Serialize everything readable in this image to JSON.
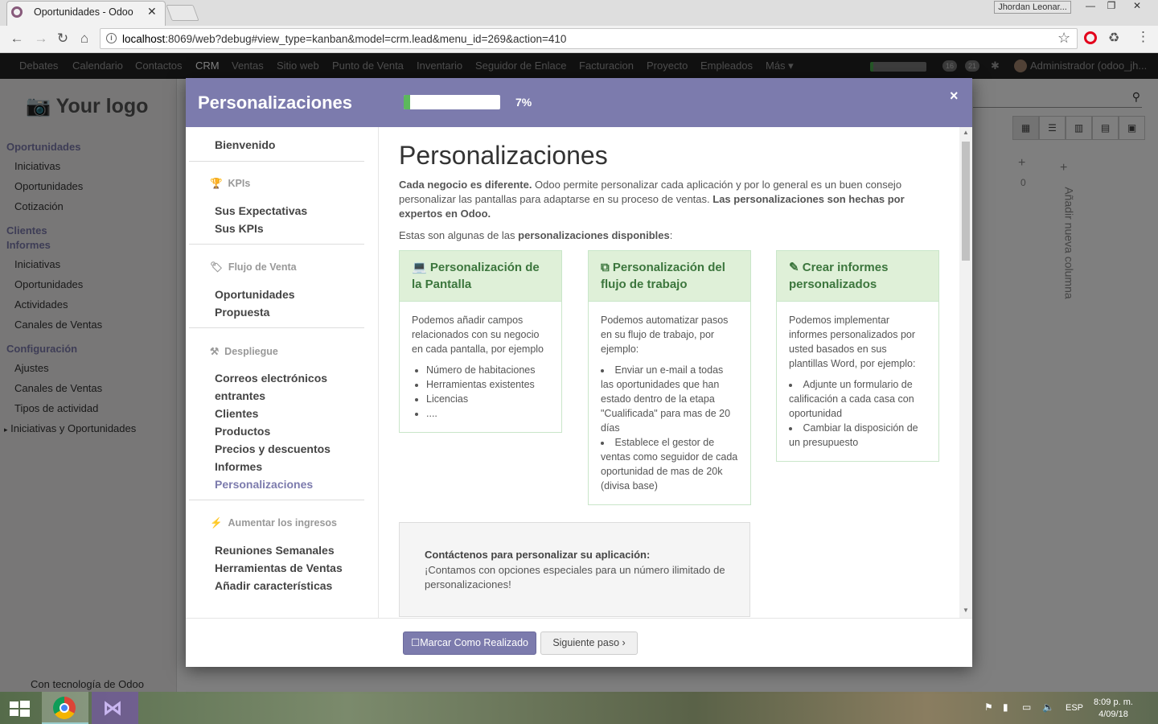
{
  "browser": {
    "tab_title": "Oportunidades - Odoo",
    "tab_close": "✕",
    "user_chip": "Jhordan Leonar...",
    "url_host": "localhost",
    "url_rest": ":8069/web?debug#view_type=kanban&model=crm.lead&menu_id=269&action=410"
  },
  "topnav": {
    "items": [
      "Debates",
      "Calendario",
      "Contactos",
      "CRM",
      "Ventas",
      "Sitio web",
      "Punto de Venta",
      "Inventario",
      "Seguidor de Enlace",
      "Facturacion",
      "Proyecto",
      "Empleados",
      "Más"
    ],
    "badge1": "16",
    "badge2": "21",
    "user": "Administrador (odoo_jh..."
  },
  "sidebar": {
    "logo": "Your logo",
    "sections": [
      {
        "head": "Oportunidades"
      },
      {
        "item": "Iniciativas"
      },
      {
        "item": "Oportunidades"
      },
      {
        "item": "Cotización"
      },
      {
        "head": "Clientes"
      },
      {
        "head": "Informes"
      },
      {
        "item": "Iniciativas"
      },
      {
        "item": "Oportunidades"
      },
      {
        "item": "Actividades"
      },
      {
        "item": "Canales de Ventas"
      },
      {
        "head": "Configuración"
      },
      {
        "item": "Ajustes"
      },
      {
        "item": "Canales de Ventas"
      },
      {
        "item": "Tipos de actividad"
      },
      {
        "item": "Iniciativas y Oportunidades"
      }
    ],
    "powered": "Con tecnología de Odoo"
  },
  "kanban": {
    "add_column": "Añadir nueva columna",
    "zero": "0"
  },
  "modal": {
    "title": "Personalizaciones",
    "progress": 0.07,
    "progress_text": "7%",
    "close": "×",
    "left_menu": {
      "bienvenido": "Bienvenido",
      "kpis_head": "KPIs",
      "kpis_items": [
        "Sus Expectativas",
        "Sus KPIs"
      ],
      "flujo_head": "Flujo de Venta",
      "flujo_items": [
        "Oportunidades",
        "Propuesta"
      ],
      "despliegue_head": "Despliegue",
      "despliegue_items": [
        "Correos electrónicos",
        "entrantes",
        "Clientes",
        "Productos",
        "Precios y descuentos",
        "Informes",
        "Personalizaciones"
      ],
      "ingresos_head": "Aumentar los ingresos",
      "ingresos_items": [
        "Reuniones Semanales",
        "Herramientas de Ventas",
        "Añadir características"
      ]
    },
    "main": {
      "title": "Personalizaciones",
      "p1_bold": "Cada negocio es diferente.",
      "p1_text": " Odoo permite personalizar cada aplicación y por lo general es un buen consejo personalizar las pantallas para adaptarse en su proceso de ventas. ",
      "p1_bold2": "Las personalizaciones son hechas por expertos en Odoo.",
      "p2_text": "Estas son algunas de las ",
      "p2_bold": "personalizaciones disponibles",
      "p2_end": ":",
      "cards": [
        {
          "title": "Personalización de la Pantalla",
          "intro": "Podemos añadir campos relacionados con su negocio en cada pantalla, por ejemplo",
          "items": [
            "Número de habitaciones",
            "Herramientas existentes",
            "Licencias",
            "...."
          ]
        },
        {
          "title": "Personalización del flujo de trabajo",
          "intro": "Podemos automatizar pasos en su flujo de trabajo, por ejemplo:",
          "items": [
            "Enviar un e-mail a todas las oportunidades que han estado dentro de la etapa \"Cualificada\" para mas de 20 días",
            "Establece el gestor de ventas como seguidor de cada oportunidad de mas de 20k (divisa base)"
          ]
        },
        {
          "title": "Crear informes personalizados",
          "intro": "Podemos implementar informes personalizados por usted basados en sus plantillas Word, por ejemplo:",
          "items": [
            "Adjunte un formulario de calificación a cada casa con oportunidad",
            "Cambiar la disposición de un presupuesto"
          ]
        }
      ],
      "contact_title": "Contáctenos para personalizar su aplicación:",
      "contact_text": "¡Contamos con opciones especiales para un número ilimitado de personalizaciones!"
    },
    "footer": {
      "done": "Marcar Como Realizado",
      "next": "Siguiente paso"
    }
  },
  "taskbar": {
    "lang": "ESP",
    "time": "8:09 p. m.",
    "date": "4/09/18"
  },
  "colors": {
    "brand": "#7c7bad",
    "success": "#5cb85c",
    "card_head": "#dff0d8"
  }
}
